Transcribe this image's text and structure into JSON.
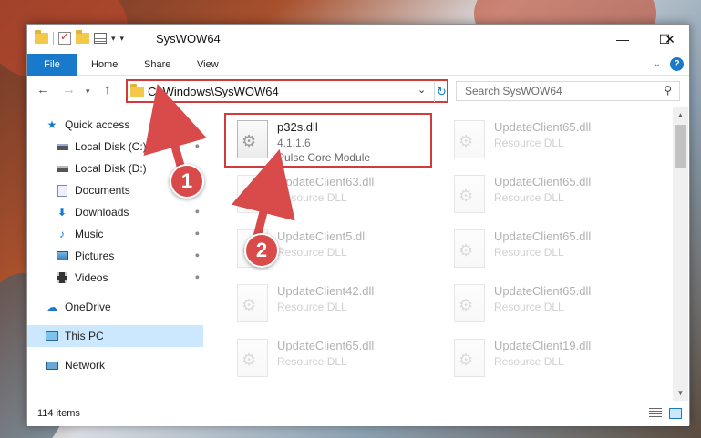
{
  "window": {
    "title": "SysWOW64",
    "controls": {
      "minimize": "—",
      "maximize": "☐",
      "close": "✕"
    }
  },
  "ribbon": {
    "tabs": [
      {
        "label": "File"
      },
      {
        "label": "Home"
      },
      {
        "label": "Share"
      },
      {
        "label": "View"
      }
    ]
  },
  "nav": {
    "address": "C:\\Windows\\SysWOW64",
    "search_placeholder": "Search SysWOW64"
  },
  "sidebar": {
    "items": [
      {
        "label": "Quick access",
        "icon": "star-icon"
      },
      {
        "label": "Local Disk (C:)",
        "icon": "drive-icon",
        "pinned": true
      },
      {
        "label": "Local Disk (D:)",
        "icon": "drive-icon"
      },
      {
        "label": "Documents",
        "icon": "documents-icon",
        "pinned": true
      },
      {
        "label": "Downloads",
        "icon": "download-icon",
        "pinned": true
      },
      {
        "label": "Music",
        "icon": "music-icon",
        "pinned": true
      },
      {
        "label": "Pictures",
        "icon": "pictures-icon",
        "pinned": true
      },
      {
        "label": "Videos",
        "icon": "videos-icon",
        "pinned": true
      },
      {
        "label": "OneDrive",
        "icon": "cloud-icon"
      },
      {
        "label": "This PC",
        "icon": "computer-icon",
        "selected": true
      },
      {
        "label": "Network",
        "icon": "network-icon"
      }
    ]
  },
  "files": {
    "highlighted": {
      "name": "p32s.dll",
      "version": "4.1.1.6",
      "description": "Pulse Core Module"
    },
    "left_column": [
      {
        "name": "UpdateClient63.dll",
        "type": "Resource DLL"
      },
      {
        "name": "UpdateClient5.dll",
        "type": "Resource DLL"
      },
      {
        "name": "UpdateClient42.dll",
        "type": "Resource DLL"
      },
      {
        "name": "UpdateClient65.dll",
        "type": "Resource DLL"
      }
    ],
    "right_column": [
      {
        "name": "UpdateClient65.dll",
        "type": "Resource DLL"
      },
      {
        "name": "UpdateClient65.dll",
        "type": "Resource DLL"
      },
      {
        "name": "UpdateClient65.dll",
        "type": "Resource DLL"
      },
      {
        "name": "UpdateClient65.dll",
        "type": "Resource DLL"
      },
      {
        "name": "UpdateClient19.dll",
        "type": "Resource DLL"
      }
    ]
  },
  "status": {
    "count": "114 items"
  },
  "callouts": {
    "one": "1",
    "two": "2"
  },
  "colors": {
    "accent": "#1979ca",
    "highlight_border": "#d23b3b",
    "callout": "#d94a4a",
    "selected_bg": "#cce8ff"
  }
}
